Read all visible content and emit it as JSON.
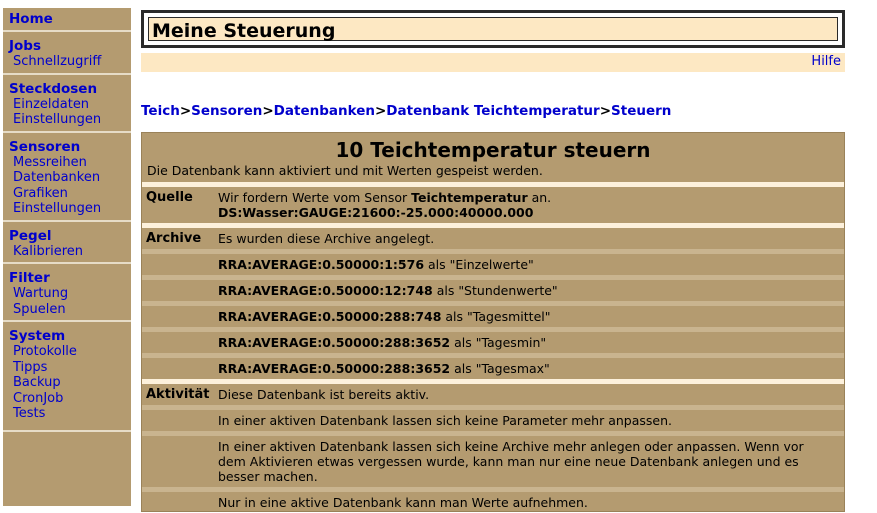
{
  "sidebar": {
    "groups": [
      {
        "head": "Home",
        "items": []
      },
      {
        "head": "Jobs",
        "items": [
          "Schnellzugriff"
        ]
      },
      {
        "head": "Steckdosen",
        "items": [
          "Einzeldaten",
          "Einstellungen"
        ]
      },
      {
        "head": "Sensoren",
        "items": [
          "Messreihen",
          "Datenbanken",
          "Grafiken",
          "Einstellungen"
        ]
      },
      {
        "head": "Pegel",
        "items": [
          "Kalibrieren"
        ]
      },
      {
        "head": "Filter",
        "items": [
          "Wartung",
          "Spuelen"
        ]
      },
      {
        "head": "System",
        "items": [
          "Protokolle",
          "Tipps",
          "Backup",
          "CronJob",
          "Tests"
        ]
      }
    ]
  },
  "header": {
    "title": "Meine Steuerung",
    "help_label": "Hilfe"
  },
  "breadcrumb": [
    "Teich",
    "Sensoren",
    "Datenbanken",
    "Datenbank Teichtemperatur",
    "Steuern"
  ],
  "breadcrumb_sep": ">",
  "panel": {
    "title": "10 Teichtemperatur steuern",
    "intro": "Die Datenbank kann aktiviert und mit Werten gespeist werden.",
    "quelle": {
      "label": "Quelle",
      "text_pre": "Wir fordern Werte vom Sensor ",
      "sensor": "Teichtemperatur",
      "text_post": " an.",
      "ds": "DS:Wasser:GAUGE:21600:-25.000:40000.000"
    },
    "archive": {
      "label": "Archive",
      "intro": "Es wurden diese Archive angelegt.",
      "items": [
        {
          "rra": "RRA:AVERAGE:0.50000:1:576",
          "als": " als ",
          "name": "\"Einzelwerte\""
        },
        {
          "rra": "RRA:AVERAGE:0.50000:12:748",
          "als": " als ",
          "name": "\"Stundenwerte\""
        },
        {
          "rra": "RRA:AVERAGE:0.50000:288:748",
          "als": " als ",
          "name": "\"Tagesmittel\""
        },
        {
          "rra": "RRA:AVERAGE:0.50000:288:3652",
          "als": " als ",
          "name": "\"Tagesmin\""
        },
        {
          "rra": "RRA:AVERAGE:0.50000:288:3652",
          "als": " als ",
          "name": "\"Tagesmax\""
        }
      ]
    },
    "aktivitaet": {
      "label": "Aktivität",
      "lines": [
        "Diese Datenbank ist bereits aktiv.",
        "In einer aktiven Datenbank lassen sich keine Parameter mehr anpassen.",
        "In einer aktiven Datenbank lassen sich keine Archive mehr anlegen oder anpassen. Wenn vor dem Aktivieren etwas vergessen wurde, kann man nur eine neue Datenbank anlegen und es besser machen.",
        "Nur in eine aktive Datenbank kann man Werte aufnehmen."
      ]
    }
  }
}
